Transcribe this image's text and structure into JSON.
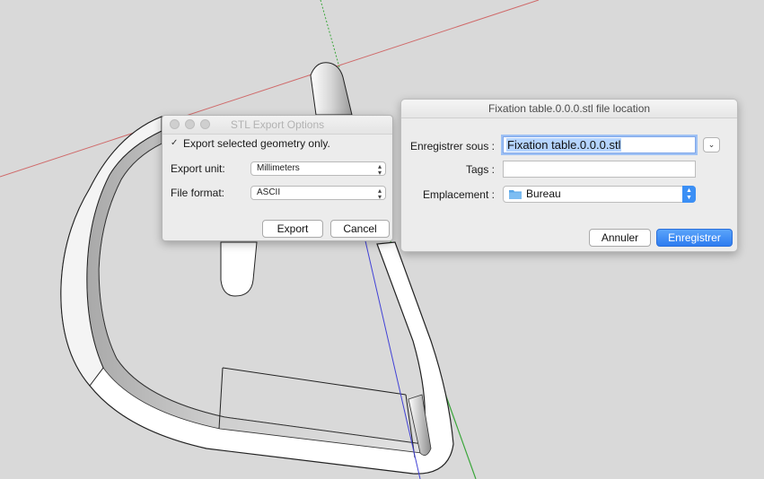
{
  "stl_dialog": {
    "title": "STL Export Options",
    "export_selected_label": "Export selected geometry only.",
    "export_selected_checked": true,
    "export_unit_label": "Export unit:",
    "export_unit_value": "Millimeters",
    "file_format_label": "File format:",
    "file_format_value": "ASCII",
    "export_button": "Export",
    "cancel_button": "Cancel"
  },
  "save_dialog": {
    "title": "Fixation table.0.0.0.stl file location",
    "save_as_label": "Enregistrer sous :",
    "save_as_value": "Fixation table.0.0.0.stl",
    "tags_label": "Tags :",
    "tags_value": "",
    "location_label": "Emplacement :",
    "location_value": "Bureau",
    "cancel_button": "Annuler",
    "save_button": "Enregistrer"
  },
  "colors": {
    "viewport_bg": "#d9d9d9",
    "axis_red": "#cc3b3b",
    "axis_green": "#3aa63a",
    "axis_blue": "#4141d6",
    "accent_blue": "#3b8ff5"
  },
  "icons": {
    "checkbox": "checkbox-checked-icon",
    "popup_arrows": "updown-arrows-icon",
    "folder": "folder-icon",
    "expand": "chevron-down-icon"
  }
}
